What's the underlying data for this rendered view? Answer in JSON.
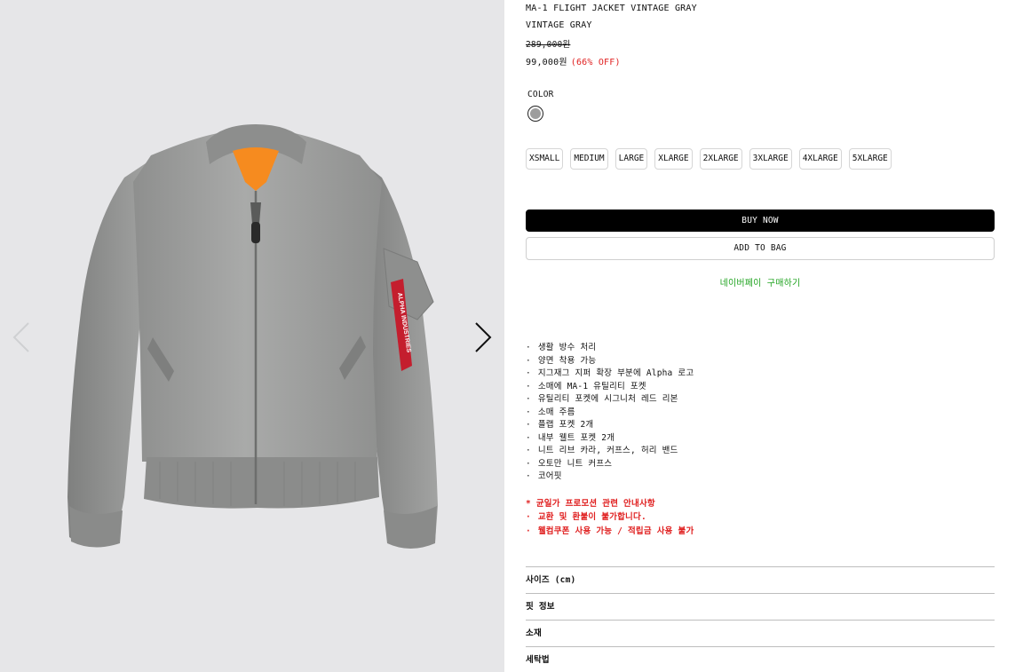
{
  "gallery": {
    "prev_label": "previous image",
    "next_label": "next image",
    "jacket_tag_text": "ALPHA INDUSTRIES"
  },
  "product": {
    "title": "MA-1 FLIGHT JACKET VINTAGE GRAY",
    "color_name": "VINTAGE GRAY",
    "original_price": "289,000원",
    "sale_price": "99,000원",
    "discount": "(66% OFF)"
  },
  "color": {
    "label": "COLOR",
    "swatch_hex": "#9d9d9d"
  },
  "sizes": [
    "XSMALL",
    "MEDIUM",
    "LARGE",
    "XLARGE",
    "2XLARGE",
    "3XLARGE",
    "4XLARGE",
    "5XLARGE"
  ],
  "actions": {
    "buy_now": "BUY NOW",
    "add_to_bag": "ADD TO BAG",
    "naverpay": "네이버페이 구매하기"
  },
  "features": [
    "생활 방수 처리",
    "양면 착용 가능",
    "지그재그 지퍼 확장 부분에 Alpha 로고",
    "소매에 MA-1 유틸리티 포켓",
    "유틸리티 포켓에 시그니처 레드 리본",
    "소매 주름",
    "플랩 포켓 2개",
    "내부 웰트 포켓 2개",
    "니트 리브 카라, 커프스, 허리 밴드",
    "오토만 니트 커프스",
    "코어핏"
  ],
  "notice": {
    "title": "* 균일가 프로모션 관련 안내사항",
    "items": [
      "교환 및 환불이 불가합니다.",
      "웰컴쿠폰 사용 가능 / 적립금 사용 불가"
    ]
  },
  "accordion": [
    "사이즈 (cm)",
    "핏 정보",
    "소재",
    "세탁법"
  ],
  "colors": {
    "accent_red": "#e02020",
    "naverpay_green": "#22a422",
    "jacket_gray": "#9a9b9a",
    "lining_orange": "#f68b1f",
    "tag_red": "#c41e2e"
  }
}
